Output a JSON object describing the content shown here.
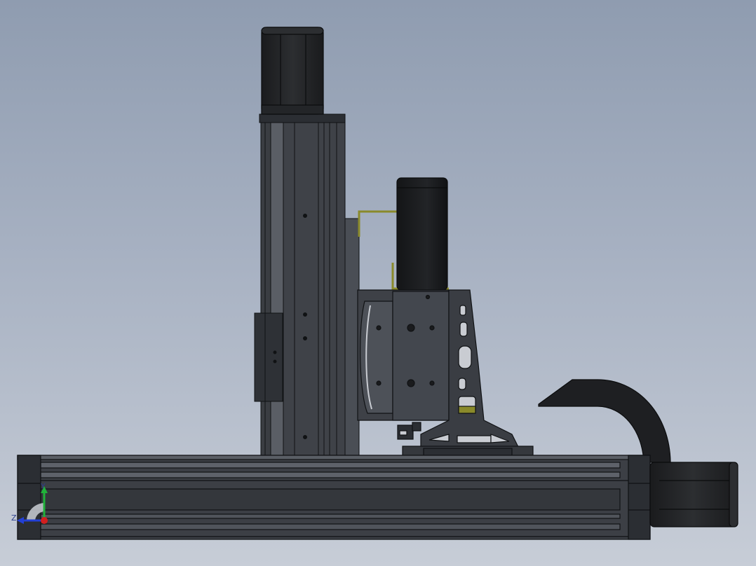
{
  "triad": {
    "y_label": "Y",
    "z_label": "Z",
    "colors": {
      "x": "#d21f1f",
      "y": "#21b23a",
      "z": "#2340d6"
    }
  },
  "palette": {
    "background_top": "#8f9cb0",
    "background_bottom": "#c7cdd7",
    "part_dark": "#2b2e33",
    "part_mid": "#43474e",
    "edge": "#101214",
    "cable_yellow": "#8a8a2a",
    "motor_black": "#1a1b1d"
  }
}
